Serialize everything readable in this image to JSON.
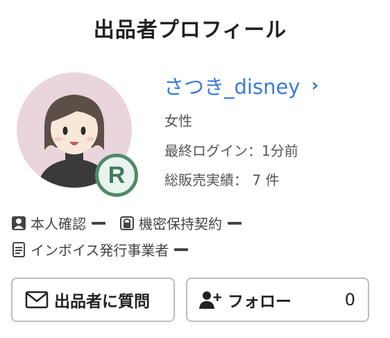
{
  "title": "出品者プロフィール",
  "seller": {
    "name": "さつき_disney",
    "gender": "女性",
    "last_login": "最終ログイン：1分前",
    "total_sales": "総販売実績： 7 件",
    "badge_letter": "R"
  },
  "verifications": [
    {
      "label": "本人確認",
      "icon": "person-card-icon"
    },
    {
      "label": "機密保持契約",
      "icon": "lock-icon"
    },
    {
      "label": "インボイス発行事業者",
      "icon": "document-icon"
    }
  ],
  "buttons": {
    "ask_label": "出品者に質問",
    "follow_label": "フォロー",
    "follow_count": "0"
  },
  "colors": {
    "link": "#3a7bd5",
    "badge_green": "#4f8a6b",
    "avatar_bg": "#ead5dc"
  }
}
